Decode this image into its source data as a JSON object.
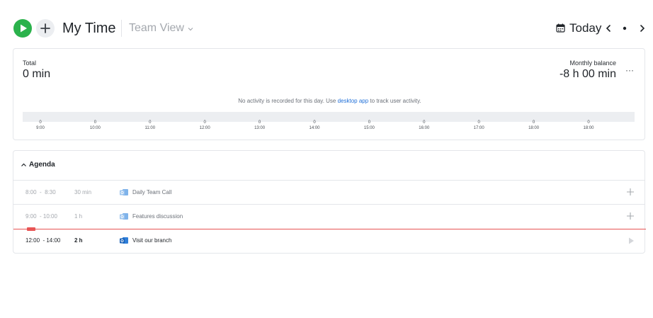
{
  "header": {
    "title": "My Time",
    "team_view_label": "Team View",
    "today_label": "Today",
    "icons": {
      "play": "play-icon",
      "add": "plus-icon",
      "calendar": "calendar-icon",
      "prev": "chevron-left-icon",
      "dot": "dot-icon",
      "next": "chevron-right-icon"
    }
  },
  "summary": {
    "total_label": "Total",
    "total_value": "0 min",
    "balance_label": "Monthly balance",
    "balance_value": "-8 h 00 min",
    "more_label": "···",
    "activity_message_pre": "No activity is recorded for this day. Use ",
    "activity_message_link": "desktop app",
    "activity_message_post": " to track user activity.",
    "timeline": [
      {
        "value": "0",
        "time": "9:00"
      },
      {
        "value": "0",
        "time": "10:00"
      },
      {
        "value": "0",
        "time": "11:00"
      },
      {
        "value": "0",
        "time": "12:00"
      },
      {
        "value": "0",
        "time": "13:00"
      },
      {
        "value": "0",
        "time": "14:00"
      },
      {
        "value": "0",
        "time": "15:00"
      },
      {
        "value": "0",
        "time": "16:00"
      },
      {
        "value": "0",
        "time": "17:00"
      },
      {
        "value": "0",
        "time": "18:00"
      },
      {
        "value": "0",
        "time": "18:00"
      }
    ]
  },
  "agenda": {
    "title": "Agenda",
    "events": [
      {
        "time": "8:00  -  8:30",
        "duration": "30 min",
        "title": "Daily Team Call",
        "status": "past"
      },
      {
        "time": "9:00  - 10:00",
        "duration": "1 h",
        "title": "Features discussion",
        "status": "past"
      },
      {
        "time": "12:00  - 14:00",
        "duration": "2 h",
        "title": "Visit our branch",
        "status": "current"
      }
    ]
  },
  "colors": {
    "accent_green": "#2bb24c",
    "link_blue": "#1f6fd8",
    "now_line_red": "#e85454",
    "event_icon_blue": "#2f7ed8"
  }
}
